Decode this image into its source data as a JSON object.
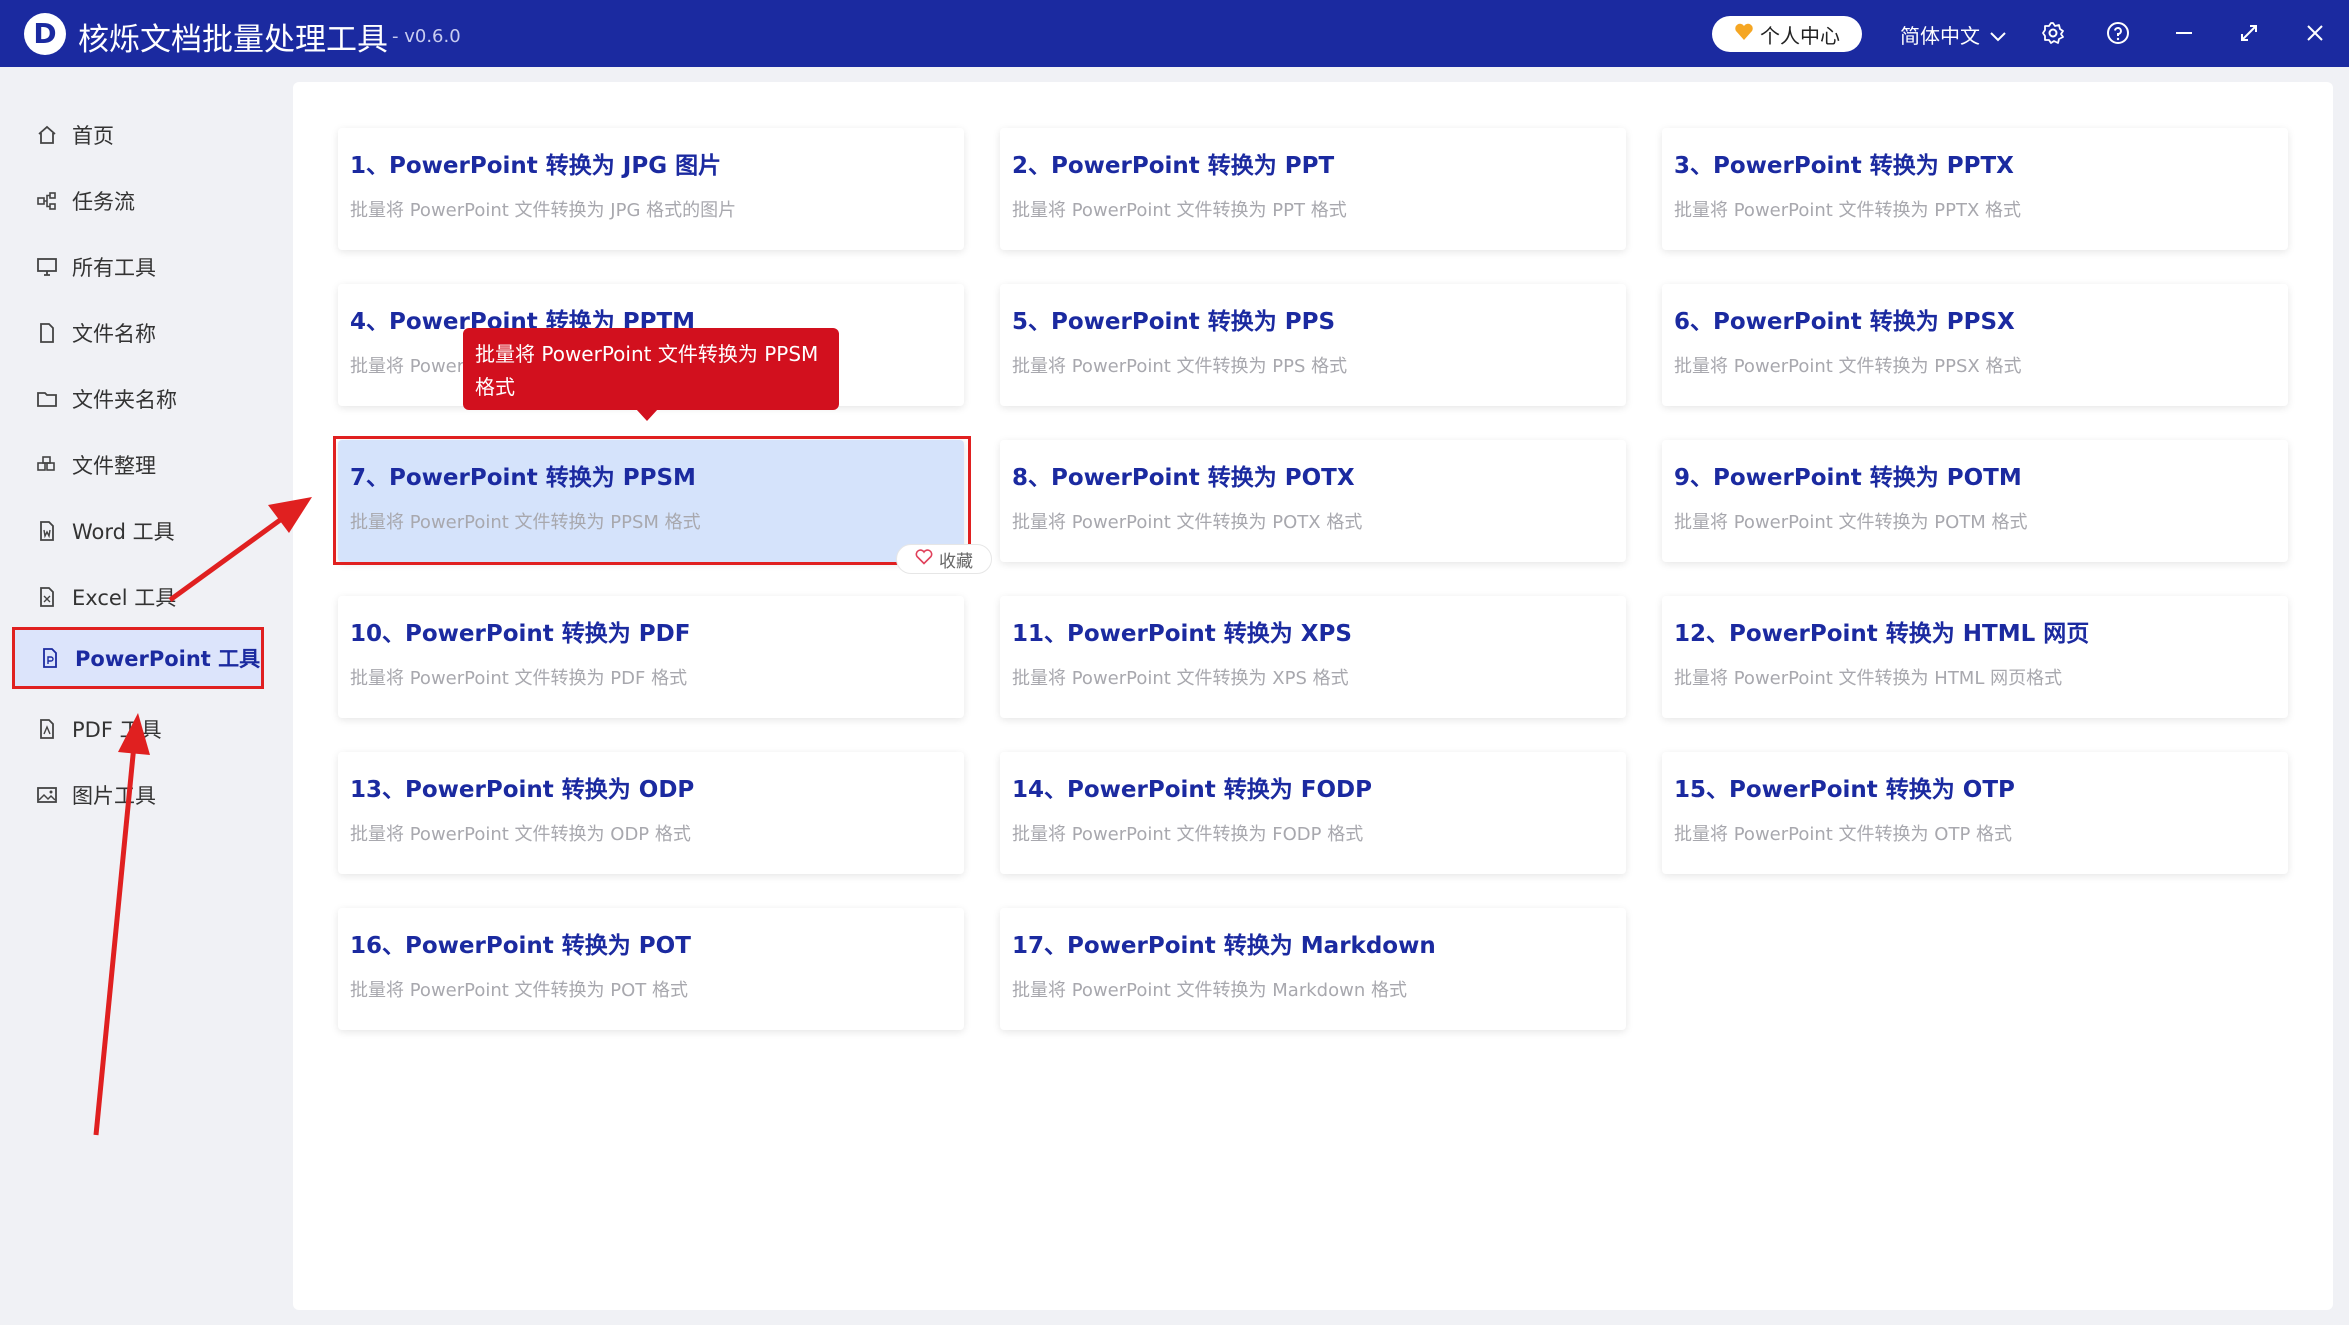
{
  "app": {
    "logo_letter": "D",
    "title": "核烁文档批量处理工具",
    "version": "- v0.6.0"
  },
  "titlebar": {
    "user_center_label": "个人中心",
    "language_label": "简体中文",
    "icons": [
      "settings-icon",
      "help-icon",
      "minimize-icon",
      "maximize-icon",
      "close-icon"
    ]
  },
  "sidebar": {
    "items": [
      {
        "label": "首页",
        "icon": "home-icon"
      },
      {
        "label": "任务流",
        "icon": "workflow-icon"
      },
      {
        "label": "所有工具",
        "icon": "monitor-icon"
      },
      {
        "label": "文件名称",
        "icon": "file-icon"
      },
      {
        "label": "文件夹名称",
        "icon": "folder-icon"
      },
      {
        "label": "文件整理",
        "icon": "organize-icon"
      },
      {
        "label": "Word 工具",
        "icon": "word-file-icon"
      },
      {
        "label": "Excel 工具",
        "icon": "excel-file-icon"
      },
      {
        "label": "PowerPoint 工具",
        "icon": "ppt-file-icon"
      },
      {
        "label": "PDF 工具",
        "icon": "pdf-file-icon"
      },
      {
        "label": "图片工具",
        "icon": "image-icon"
      }
    ],
    "active_index": 8
  },
  "tools": [
    {
      "title": "1、PowerPoint 转换为 JPG 图片",
      "desc": "批量将 PowerPoint 文件转换为 JPG 格式的图片"
    },
    {
      "title": "2、PowerPoint 转换为 PPT",
      "desc": "批量将 PowerPoint 文件转换为 PPT 格式"
    },
    {
      "title": "3、PowerPoint 转换为 PPTX",
      "desc": "批量将 PowerPoint 文件转换为 PPTX 格式"
    },
    {
      "title": "4、PowerPoint 转换为 PPTM",
      "desc": "批量将 PowerPoint 文件转换为 PPTM 格式"
    },
    {
      "title": "5、PowerPoint 转换为 PPS",
      "desc": "批量将 PowerPoint 文件转换为 PPS 格式"
    },
    {
      "title": "6、PowerPoint 转换为 PPSX",
      "desc": "批量将 PowerPoint 文件转换为 PPSX 格式"
    },
    {
      "title": "7、PowerPoint 转换为 PPSM",
      "desc": "批量将 PowerPoint 文件转换为 PPSM 格式"
    },
    {
      "title": "8、PowerPoint 转换为 POTX",
      "desc": "批量将 PowerPoint 文件转换为 POTX 格式"
    },
    {
      "title": "9、PowerPoint 转换为 POTM",
      "desc": "批量将 PowerPoint 文件转换为 POTM 格式"
    },
    {
      "title": "10、PowerPoint 转换为 PDF",
      "desc": "批量将 PowerPoint 文件转换为 PDF 格式"
    },
    {
      "title": "11、PowerPoint 转换为 XPS",
      "desc": "批量将 PowerPoint 文件转换为 XPS 格式"
    },
    {
      "title": "12、PowerPoint 转换为 HTML 网页",
      "desc": "批量将 PowerPoint 文件转换为 HTML 网页格式"
    },
    {
      "title": "13、PowerPoint 转换为 ODP",
      "desc": "批量将 PowerPoint 文件转换为 ODP 格式"
    },
    {
      "title": "14、PowerPoint 转换为 FODP",
      "desc": "批量将 PowerPoint 文件转换为 FODP 格式"
    },
    {
      "title": "15、PowerPoint 转换为 OTP",
      "desc": "批量将 PowerPoint 文件转换为 OTP 格式"
    },
    {
      "title": "16、PowerPoint 转换为 POT",
      "desc": "批量将 PowerPoint 文件转换为 POT 格式"
    },
    {
      "title": "17、PowerPoint 转换为 Markdown",
      "desc": "批量将 PowerPoint 文件转换为 Markdown 格式"
    }
  ],
  "highlighted_tool_index": 6,
  "tooltip": {
    "text": "批量将 PowerPoint 文件转换为 PPSM 格式"
  },
  "favorite_button": {
    "label": "收藏"
  },
  "colors": {
    "titlebar": "#1b2aa0",
    "accent": "#1b2aa0",
    "annotation_red": "#e02020",
    "tooltip_bg": "#d2101e",
    "highlight_card": "#d5e3fb"
  }
}
